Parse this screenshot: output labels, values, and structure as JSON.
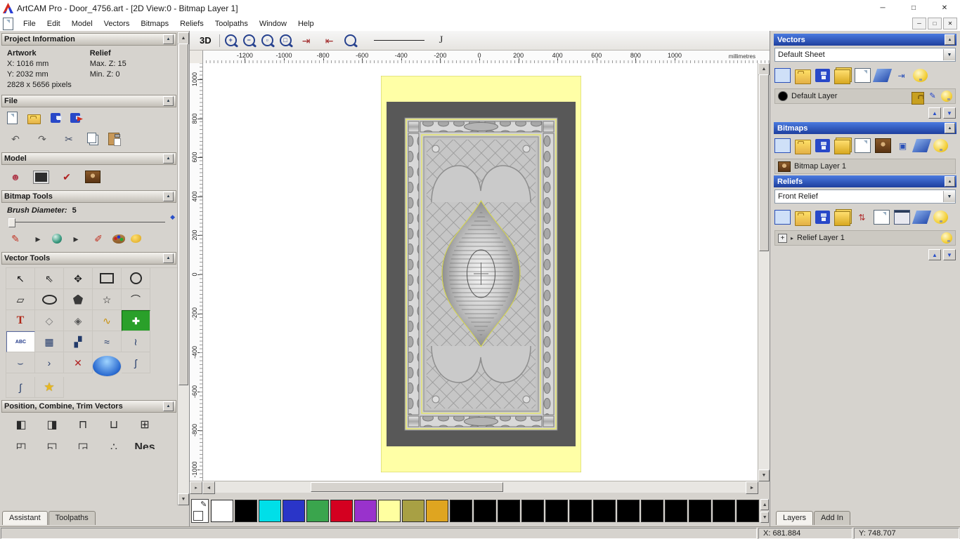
{
  "window": {
    "title": "ArtCAM Pro - Door_4756.art - [2D View:0 - Bitmap Layer 1]",
    "minimize": "─",
    "restore": "□",
    "close": "✕"
  },
  "ui": {
    "up": "▲",
    "down": "▼",
    "left": "◄",
    "right": "►",
    "collapse": "▲",
    "dropdown": "▼",
    "flyout": "▸"
  },
  "menu": {
    "items": [
      "File",
      "Edit",
      "Model",
      "Vectors",
      "Bitmaps",
      "Reliefs",
      "Toolpaths",
      "Window",
      "Help"
    ]
  },
  "assistant": {
    "project": {
      "title": "Project Information",
      "artwork_label": "Artwork",
      "relief_label": "Relief",
      "x": "X: 1016 mm",
      "y": "Y: 2032 mm",
      "max_z": "Max. Z: 15",
      "min_z": "Min. Z: 0",
      "pixels": "2828 x 5656 pixels"
    },
    "file": {
      "title": "File",
      "row1": [
        {
          "name": "new-model",
          "cls": "i-page"
        },
        {
          "name": "open-model",
          "cls": "i-folder"
        },
        {
          "name": "save-model",
          "cls": "i-floppy"
        },
        {
          "name": "export-model",
          "cls": "i-export"
        }
      ],
      "row2": [
        {
          "name": "undo",
          "glyph": "↶",
          "color": "#5a5a5a"
        },
        {
          "name": "redo",
          "glyph": "↷",
          "color": "#5a5a5a"
        },
        {
          "name": "cut",
          "glyph": "✂",
          "color": "#44506a"
        },
        {
          "name": "copy",
          "cls": "i-copy"
        },
        {
          "name": "paste",
          "cls": "i-paste"
        }
      ]
    },
    "model": {
      "title": "Model",
      "icons": [
        {
          "name": "set-model-size",
          "glyph": "☻",
          "color": "#b04050"
        },
        {
          "name": "greyscale-preview",
          "cls": "i-photo"
        },
        {
          "name": "relief-preview",
          "glyph": "✔",
          "color": "#b02020"
        },
        {
          "name": "load-reference-image",
          "cls": "i-mona"
        }
      ]
    },
    "bitmap_tools": {
      "title": "Bitmap Tools",
      "brush_label": "Brush Diameter:",
      "brush_value": "5",
      "icons": [
        {
          "name": "paint",
          "glyph": "✎",
          "color": "#c03020"
        },
        {
          "name": "paint-flyout",
          "glyph": "▸",
          "color": "#333"
        },
        {
          "name": "paint-selective",
          "cls": "i-sphere"
        },
        {
          "name": "paint-selective-flyout",
          "glyph": "▸",
          "color": "#333"
        },
        {
          "name": "airbrush",
          "glyph": "✐",
          "color": "#c03020"
        },
        {
          "name": "colour-palette",
          "cls": "i-palette"
        },
        {
          "name": "flood-fill",
          "cls": "i-blob"
        }
      ]
    },
    "vector_tools": {
      "title": "Vector Tools",
      "icons": [
        {
          "name": "select-vectors",
          "glyph": "↖",
          "color": "#111"
        },
        {
          "name": "node-editing",
          "glyph": "⇖",
          "color": "#222"
        },
        {
          "name": "transform-vectors",
          "glyph": "✥",
          "color": "#222"
        },
        {
          "name": "create-rectangle",
          "cls": "s-rect"
        },
        {
          "name": "create-circle",
          "cls": "s-circle"
        },
        {
          "name": "create-polyline",
          "glyph": "▱",
          "color": "#222"
        },
        {
          "name": "create-ellipse",
          "cls": "s-ellipse"
        },
        {
          "name": "create-polygon",
          "cls": "s-pentagon"
        },
        {
          "name": "create-star",
          "glyph": "☆",
          "color": "#222"
        },
        {
          "name": "create-arc",
          "glyph": "⌒",
          "color": "#222"
        },
        {
          "name": "create-text",
          "glyph": "T",
          "cls": "g-serif",
          "color": "#b02818"
        },
        {
          "name": "wrap-text",
          "glyph": "◇",
          "color": "#777"
        },
        {
          "name": "offset-vector",
          "glyph": "◈",
          "color": "#555"
        },
        {
          "name": "create-spiral",
          "glyph": "∿",
          "color": "#c8900a"
        },
        {
          "name": "paste-along-curve",
          "glyph": "✚",
          "cls": "i-greencross"
        },
        {
          "name": "text-block",
          "glyph": "ABC",
          "cls": "i-abc"
        },
        {
          "name": "vector-grid",
          "glyph": "▦",
          "color": "#223a6a"
        },
        {
          "name": "block-copy",
          "glyph": "▞",
          "color": "#223a6a"
        },
        {
          "name": "fit-curve",
          "glyph": "≈",
          "color": "#223a6a"
        },
        {
          "name": "fit-polyline",
          "glyph": "≀",
          "color": "#223a6a"
        },
        {
          "name": "create-boundary",
          "glyph": "⌣",
          "color": "#223a6a"
        },
        {
          "name": "join-vectors",
          "glyph": "›",
          "color": "#223a6a"
        },
        {
          "name": "trim-vectors",
          "glyph": "✕",
          "color": "#b02020"
        },
        {
          "name": "extrude-relief",
          "cls": "i-disc"
        },
        {
          "name": "free-curve",
          "glyph": "ʃ",
          "color": "#223a6a"
        },
        {
          "name": "fillet-curve",
          "glyph": "∫",
          "color": "#223a6a"
        },
        {
          "name": "star-wizard",
          "glyph": "★",
          "cls": "g-star",
          "color": "#e8b820"
        }
      ]
    },
    "position_tools": {
      "title": "Position, Combine, Trim Vectors",
      "row1": [
        {
          "name": "align-left-edges",
          "glyph": "◧"
        },
        {
          "name": "align-right-edges",
          "glyph": "◨"
        },
        {
          "name": "align-top-edges",
          "glyph": "⊓"
        },
        {
          "name": "align-bottom-edges",
          "glyph": "⊔"
        },
        {
          "name": "align-centre",
          "glyph": "⊞"
        }
      ],
      "row2": [
        {
          "name": "centre-in-page-left",
          "glyph": "◰"
        },
        {
          "name": "centre-in-page-bottom",
          "glyph": "◱"
        },
        {
          "name": "centre-in-page-right",
          "glyph": "◲"
        },
        {
          "name": "scatter-vectors",
          "glyph": "∴"
        },
        {
          "name": "nest-vectors",
          "glyph": "Nes",
          "cls": "g-text"
        }
      ]
    },
    "tabs": [
      {
        "label": "Assistant",
        "active": true
      },
      {
        "label": "Toolpaths",
        "active": false
      }
    ]
  },
  "canvas": {
    "toolbar": {
      "view3d": "3D",
      "icons": [
        {
          "name": "zoom-in",
          "glyph": "+",
          "cls": "mag"
        },
        {
          "name": "zoom-out",
          "glyph": "−",
          "cls": "mag"
        },
        {
          "name": "zoom-window",
          "glyph": "▫",
          "cls": "mag"
        },
        {
          "name": "zoom-fit",
          "glyph": "□",
          "cls": "mag"
        },
        {
          "name": "snap-to-left",
          "glyph": "⇥",
          "color": "#a02828"
        },
        {
          "name": "snap-to-right",
          "glyph": "⇤",
          "color": "#a02828"
        },
        {
          "name": "zoom-previous",
          "glyph": "",
          "cls": "mag"
        }
      ]
    },
    "ruler_h": {
      "units": "millimetres",
      "ticks": [
        {
          "label": "-1200",
          "mm": -1200
        },
        {
          "label": "-1000",
          "mm": -1000
        },
        {
          "label": "-800",
          "mm": -800
        },
        {
          "label": "-600",
          "mm": -600
        },
        {
          "label": "-400",
          "mm": -400
        },
        {
          "label": "-200",
          "mm": -200
        },
        {
          "label": "0",
          "mm": 0
        },
        {
          "label": "200",
          "mm": 200
        },
        {
          "label": "400",
          "mm": 400
        },
        {
          "label": "600",
          "mm": 600
        },
        {
          "label": "800",
          "mm": 800
        },
        {
          "label": "1000",
          "mm": 1000
        }
      ]
    },
    "ruler_v": {
      "ticks": [
        {
          "label": "1000",
          "mm": 1000
        },
        {
          "label": "800",
          "mm": 800
        },
        {
          "label": "600",
          "mm": 600
        },
        {
          "label": "400",
          "mm": 400
        },
        {
          "label": "200",
          "mm": 200
        },
        {
          "label": "0",
          "mm": 0
        },
        {
          "label": "-200",
          "mm": -200
        },
        {
          "label": "-400",
          "mm": -400
        },
        {
          "label": "-600",
          "mm": -600
        },
        {
          "label": "-800",
          "mm": -800
        },
        {
          "label": "-1000",
          "mm": -1000
        }
      ]
    }
  },
  "palette": {
    "swatches": [
      "#ffffff",
      "#000000",
      "#00dfe8",
      "#2a35c8",
      "#3aa54d",
      "#d40020",
      "#9932cc",
      "#ffffa0",
      "#a8a044",
      "#dfa520",
      "#000000",
      "#000000",
      "#000000",
      "#000000",
      "#000000",
      "#000000",
      "#000000",
      "#000000",
      "#000000",
      "#000000",
      "#000000",
      "#000000",
      "#000000"
    ]
  },
  "right_panel": {
    "vectors": {
      "title": "Vectors",
      "sheet": "Default Sheet",
      "icons": [
        {
          "name": "import-vectors",
          "cls": "i-page-b"
        },
        {
          "name": "open-vector-file",
          "cls": "i-folder"
        },
        {
          "name": "save-vectors",
          "cls": "i-floppy"
        },
        {
          "name": "sheet-manager",
          "cls": "i-stack"
        },
        {
          "name": "new-vector-layer",
          "cls": "i-page"
        },
        {
          "name": "delete-vector-layer",
          "cls": "i-eraser"
        },
        {
          "name": "merge-visible-layers",
          "glyph": "⇥",
          "color": "#2a50b8"
        },
        {
          "name": "toggle-all-vector-layers",
          "cls": "i-bulb"
        }
      ],
      "layer": {
        "name": "Default Layer",
        "icons": [
          {
            "name": "snap-layer",
            "cls": "i-lock"
          },
          {
            "name": "edit-layer-colour",
            "glyph": "✎",
            "color": "#2244cc"
          },
          {
            "name": "vector-layer-visibility",
            "cls": "i-bulb"
          }
        ]
      }
    },
    "bitmaps": {
      "title": "Bitmaps",
      "icons": [
        {
          "name": "import-bitmap",
          "cls": "i-page-b"
        },
        {
          "name": "open-bitmap-file",
          "cls": "i-folder"
        },
        {
          "name": "save-bitmap",
          "cls": "i-floppy"
        },
        {
          "name": "bitmap-manager",
          "cls": "i-stack"
        },
        {
          "name": "new-bitmap-layer",
          "cls": "i-page"
        },
        {
          "name": "bitmap-preview",
          "cls": "i-mona-sm"
        },
        {
          "name": "bitmap-to-vector",
          "glyph": "▣",
          "color": "#2a50b8"
        },
        {
          "name": "delete-bitmap-layer",
          "cls": "i-eraser"
        },
        {
          "name": "toggle-bitmap-layers",
          "cls": "i-bulb"
        }
      ],
      "layer": {
        "name": "Bitmap Layer 1"
      }
    },
    "reliefs": {
      "title": "Reliefs",
      "relief": "Front Relief",
      "icons": [
        {
          "name": "import-relief",
          "cls": "i-page-b"
        },
        {
          "name": "open-relief-file",
          "cls": "i-folder"
        },
        {
          "name": "save-relief",
          "cls": "i-floppy"
        },
        {
          "name": "relief-manager",
          "cls": "i-stack"
        },
        {
          "name": "swap-front-back-relief",
          "glyph": "⇅",
          "color": "#b03030"
        },
        {
          "name": "new-relief-layer",
          "cls": "i-page"
        },
        {
          "name": "calculate-relief",
          "cls": "i-calc"
        },
        {
          "name": "delete-relief-layer",
          "cls": "i-eraser"
        },
        {
          "name": "toggle-relief-layers",
          "cls": "i-bulb"
        }
      ],
      "layer": {
        "name": "Relief Layer 1",
        "plus": "+",
        "icons": [
          {
            "name": "relief-layer-visibility",
            "cls": "i-bulb"
          }
        ]
      }
    },
    "tabs": [
      {
        "label": "Layers",
        "active": true
      },
      {
        "label": "Add In",
        "active": false
      }
    ]
  },
  "status": {
    "x": "X: 681.884",
    "y": "Y: 748.707"
  }
}
